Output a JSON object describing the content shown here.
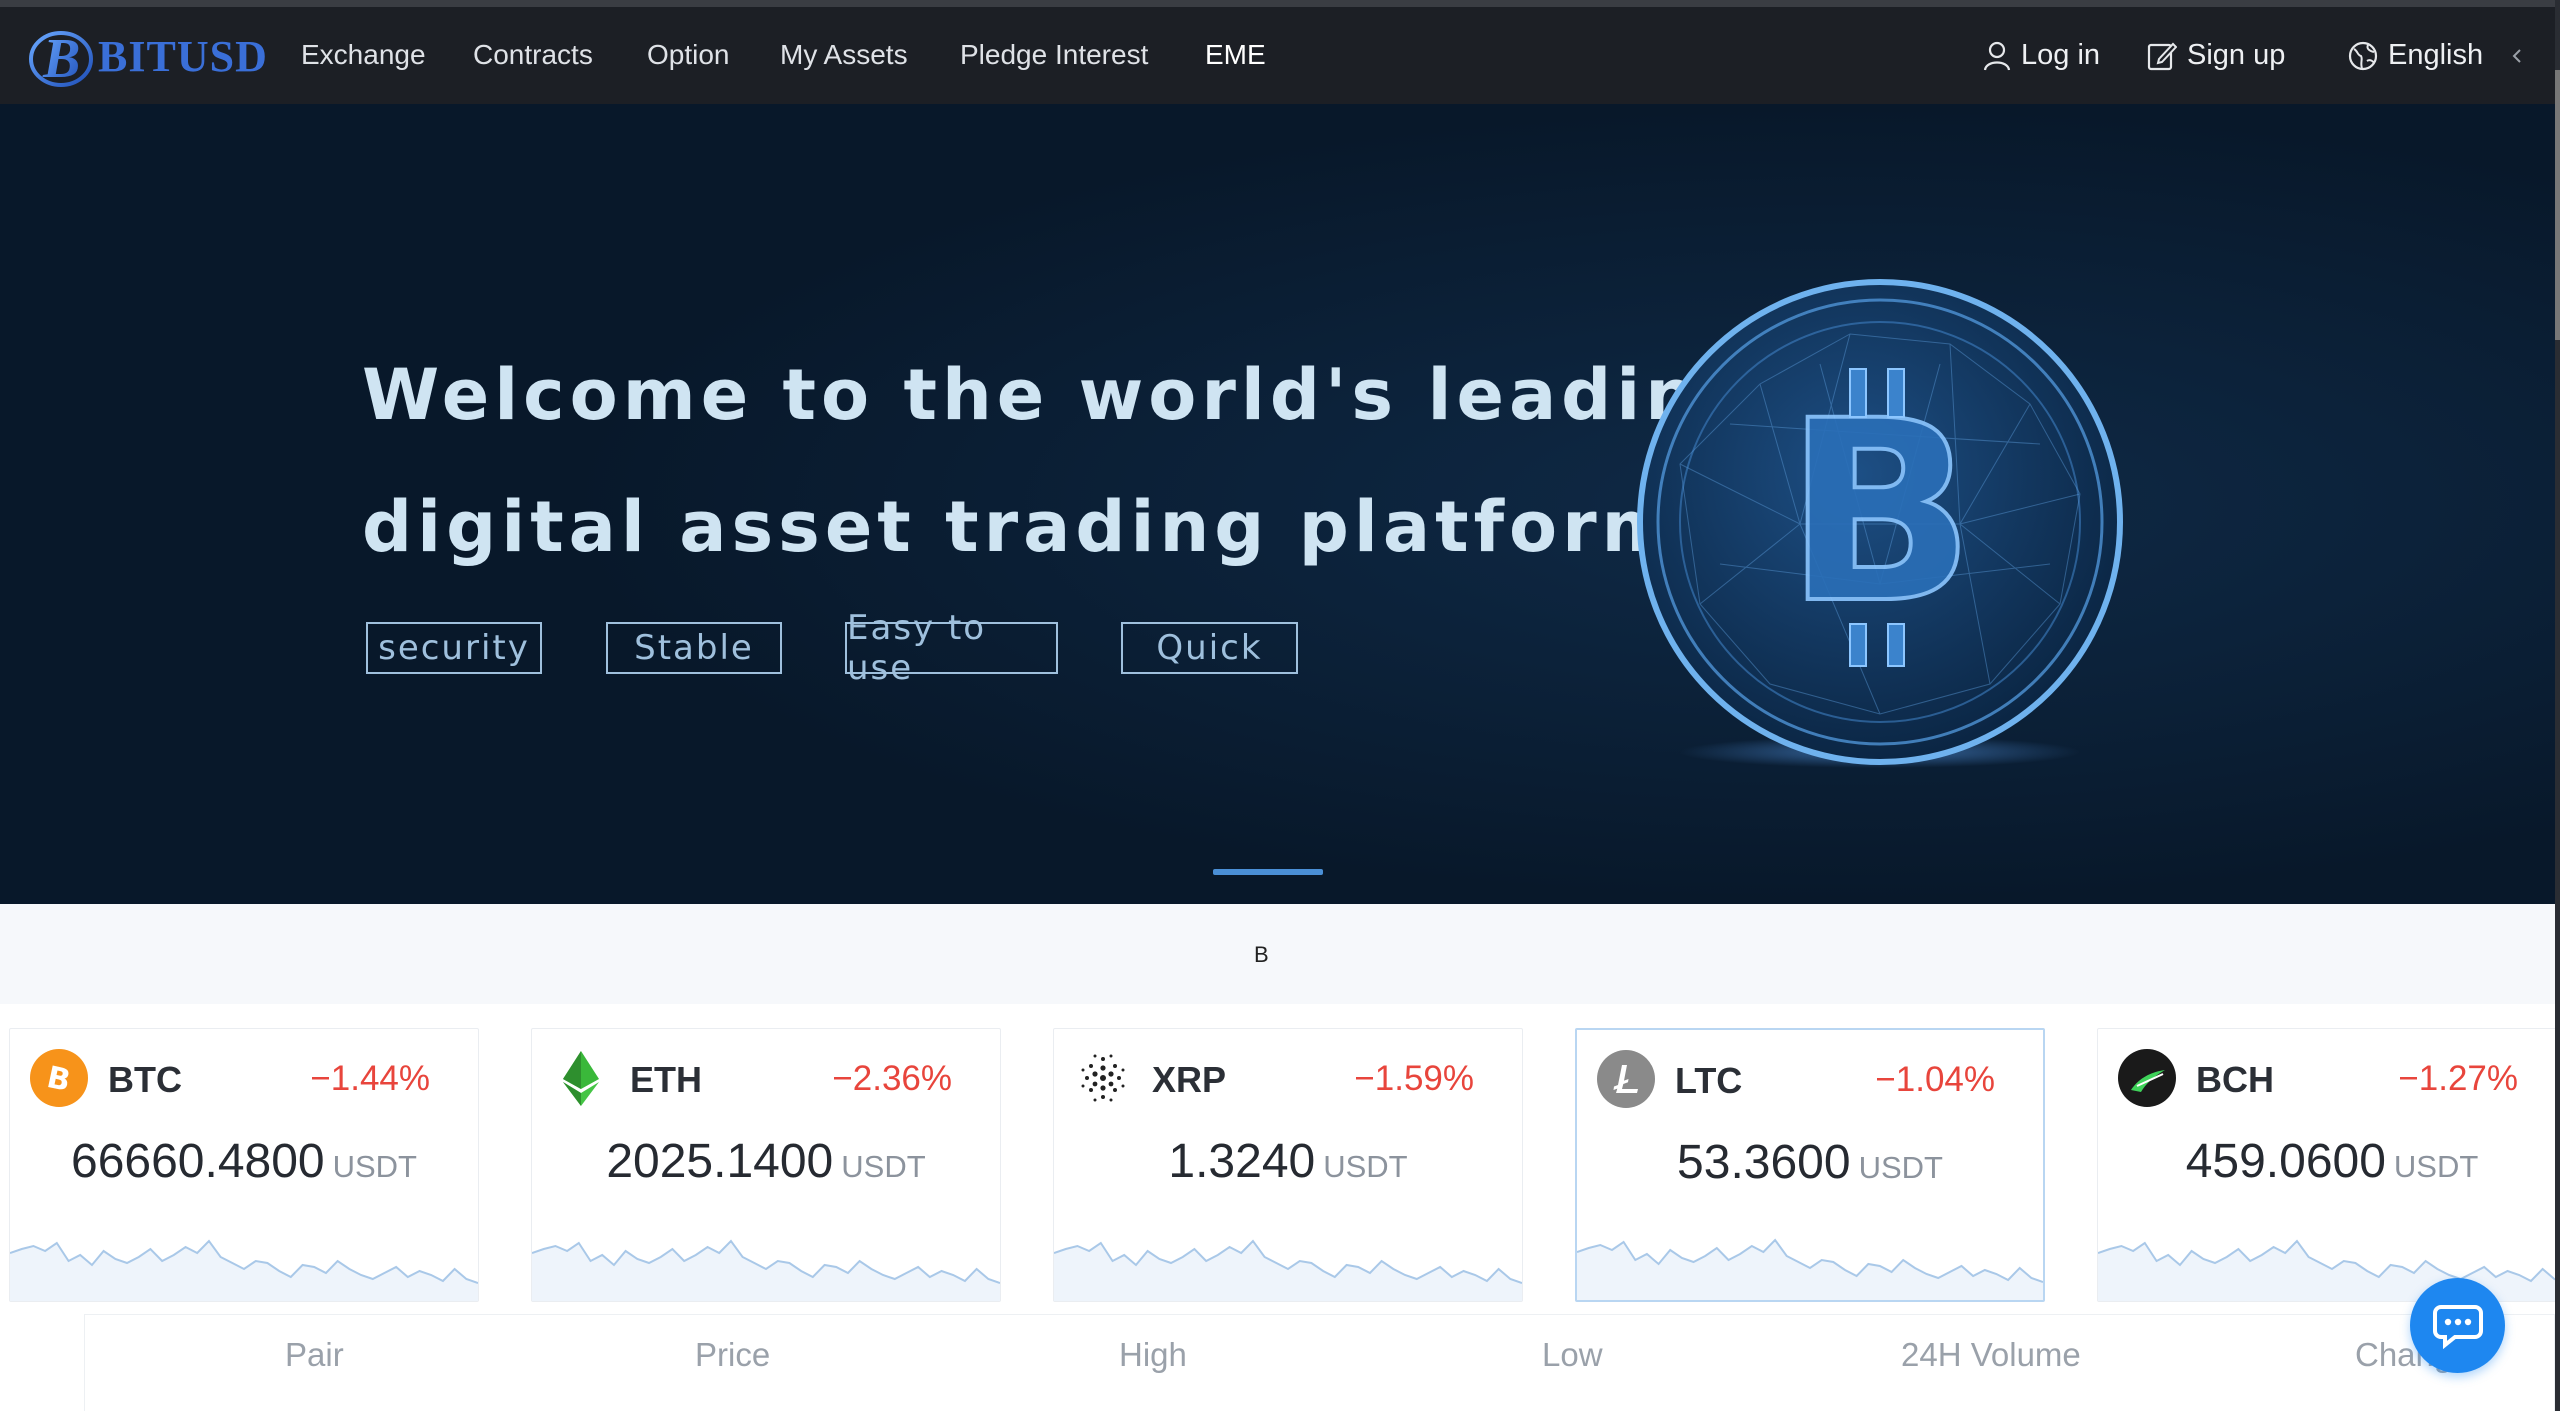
{
  "brand": {
    "logo_letter": "B",
    "logo_text": "BITUSD"
  },
  "nav": {
    "items": [
      "Exchange",
      "Contracts",
      "Option",
      "My Assets",
      "Pledge Interest",
      "EME"
    ],
    "login": "Log in",
    "signup": "Sign up",
    "language": "English"
  },
  "hero": {
    "title_line1": "Welcome to the world's leading",
    "title_line2": "digital asset trading platform",
    "tags": [
      "security",
      "Stable",
      "Easy to use",
      "Quick"
    ]
  },
  "band": {
    "text": "B"
  },
  "tickers": [
    {
      "symbol": "BTC",
      "change": "−1.44%",
      "price": "66660.4800",
      "unit": "USDT",
      "icon": "btc-icon",
      "color": "#f7931a"
    },
    {
      "symbol": "ETH",
      "change": "−2.36%",
      "price": "2025.1400",
      "unit": "USDT",
      "icon": "eth-icon",
      "color": "#3ab83a"
    },
    {
      "symbol": "XRP",
      "change": "−1.59%",
      "price": "1.3240",
      "unit": "USDT",
      "icon": "xrp-icon",
      "color": "#222222"
    },
    {
      "symbol": "LTC",
      "change": "−1.04%",
      "price": "53.3600",
      "unit": "USDT",
      "icon": "ltc-icon",
      "color": "#8a8a8a"
    },
    {
      "symbol": "BCH",
      "change": "−1.27%",
      "price": "459.0600",
      "unit": "USDT",
      "icon": "bch-icon",
      "color": "#1a1a1a"
    }
  ],
  "table": {
    "headers": [
      "Pair",
      "Price",
      "High",
      "Low",
      "24H Volume",
      "Change"
    ]
  },
  "colors": {
    "accent": "#1e87f0",
    "down": "#e8453c",
    "hero_bg": "#08182a",
    "nav_bg": "#1c1f25"
  }
}
